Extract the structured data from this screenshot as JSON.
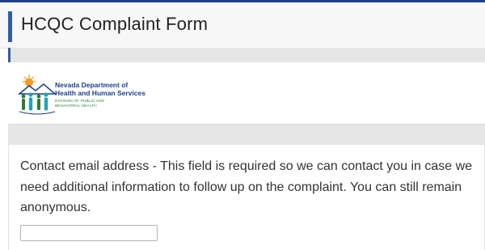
{
  "header": {
    "title": "HCQC Complaint Form"
  },
  "logo": {
    "line1": "Nevada Department of",
    "line2": "Health and Human Services",
    "line3": "DIVISION OF PUBLIC AND",
    "line4": "BEHAVIORAL HEALTH",
    "colors": {
      "primary_blue": "#1f3f8a",
      "green": "#2e7d32",
      "orange": "#f29c1f",
      "teal": "#23a3b8"
    }
  },
  "question": {
    "label": "Contact email address - This field is required so we can contact you in case we need additional information to follow up on the complaint. You can still remain anonymous.",
    "value": ""
  },
  "colors": {
    "accent": "#2e5fa6",
    "top_strip": "#1f3f8a",
    "band": "#e6e6e6"
  }
}
